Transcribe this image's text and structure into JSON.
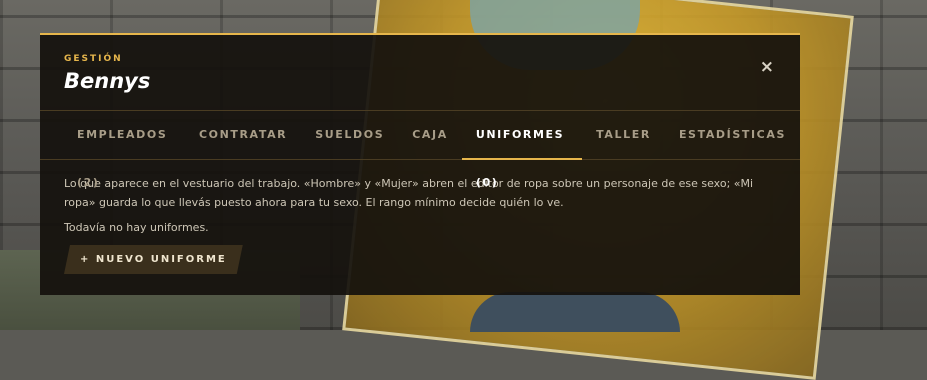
{
  "panel": {
    "kicker": "GESTIÓN",
    "title": "Bennys",
    "close_glyph": "×"
  },
  "tabs": [
    {
      "label": "EMPLEADOS (2)",
      "active": false
    },
    {
      "label": "CONTRATAR",
      "active": false
    },
    {
      "label": "SUELDOS",
      "active": false
    },
    {
      "label": "CAJA",
      "active": false
    },
    {
      "label": "UNIFORMES (0)",
      "active": true
    },
    {
      "label": "TALLER",
      "active": false
    },
    {
      "label": "ESTADÍSTICAS",
      "active": false
    }
  ],
  "content": {
    "description": "Lo que aparece en el vestuario del trabajo. «Hombre» y «Mujer» abren el editor de ropa sobre un personaje de ese sexo; «Mi ropa» guarda lo que llevás puesto ahora para tu sexo. El rango mínimo decide quién lo ve.",
    "empty_text": "Todavía no hay uniformes.",
    "new_button_label": "+ NUEVO UNIFORME"
  },
  "colors": {
    "accent": "#e6b64c",
    "panel_bg": "#14110d",
    "text_muted": "#a89d88"
  }
}
